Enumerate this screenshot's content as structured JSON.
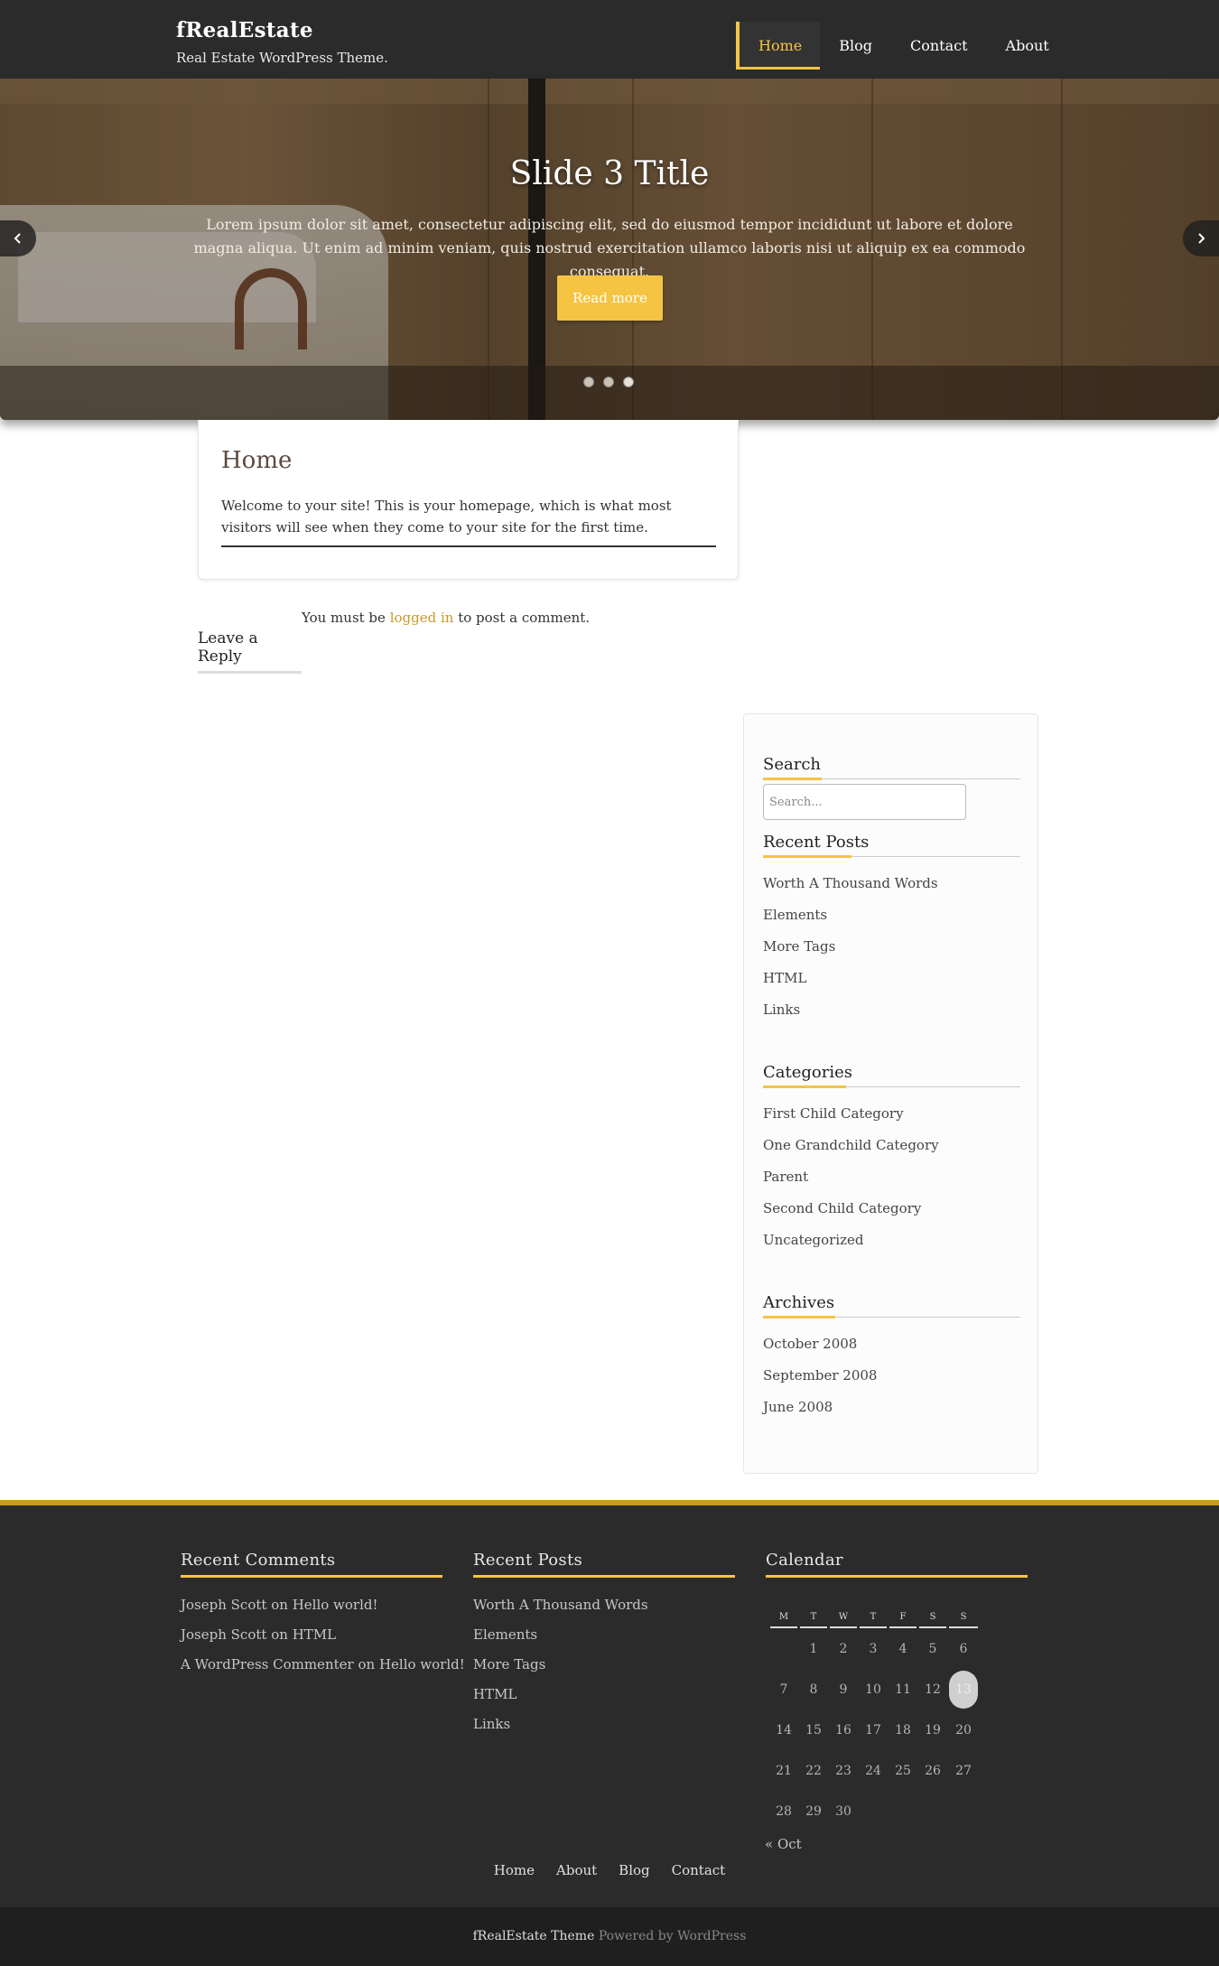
{
  "site": {
    "title": "fRealEstate",
    "tagline": "Real Estate WordPress Theme."
  },
  "nav": {
    "items": [
      {
        "label": "Home",
        "active": true
      },
      {
        "label": "Blog",
        "active": false
      },
      {
        "label": "Contact",
        "active": false
      },
      {
        "label": "About",
        "active": false
      }
    ]
  },
  "slider": {
    "title": "Slide 3 Title",
    "text": "Lorem ipsum dolor sit amet, consectetur adipiscing elit, sed do eiusmod tempor incididunt ut labore et dolore magna aliqua. Ut enim ad minim veniam, quis nostrud exercitation ullamco laboris nisi ut aliquip ex ea commodo consequat.",
    "button_label": "Read more",
    "slide_count": 3,
    "active_slide": 3,
    "prev_icon": "chevron-left-icon",
    "next_icon": "chevron-right-icon"
  },
  "page": {
    "title": "Home",
    "body": "Welcome to your site! This is your homepage, which is what most visitors will see when they come to your site for the first time."
  },
  "comments": {
    "note_prefix": "You must be ",
    "note_link": "logged in",
    "note_suffix": " to post a comment.",
    "reply_title": "Leave a Reply"
  },
  "sidebar": {
    "search": {
      "title": "Search",
      "placeholder": "Search..."
    },
    "recent_posts": {
      "title": "Recent Posts",
      "items": [
        "Worth A Thousand Words",
        "Elements",
        "More Tags",
        "HTML",
        "Links"
      ]
    },
    "categories": {
      "title": "Categories",
      "items": [
        "First Child Category",
        "One Grandchild Category",
        "Parent",
        "Second Child Category",
        "Uncategorized"
      ]
    },
    "archives": {
      "title": "Archives",
      "items": [
        "October 2008",
        "September 2008",
        "June 2008"
      ]
    }
  },
  "footer": {
    "recent_comments": {
      "title": "Recent Comments",
      "items": [
        {
          "author": "Joseph Scott",
          "on": "on",
          "post": "Hello world!"
        },
        {
          "author": "Joseph Scott",
          "on": "on",
          "post": "HTML"
        },
        {
          "author": "A WordPress Commenter",
          "on": "on",
          "post": "Hello world!"
        }
      ]
    },
    "recent_posts": {
      "title": "Recent Posts",
      "items": [
        "Worth A Thousand Words",
        "Elements",
        "More Tags",
        "HTML",
        "Links"
      ]
    },
    "calendar": {
      "title": "Calendar",
      "weekdays": [
        "M",
        "T",
        "W",
        "T",
        "F",
        "S",
        "S"
      ],
      "weeks": [
        [
          "",
          "1",
          "2",
          "3",
          "4",
          "5",
          "6"
        ],
        [
          "7",
          "8",
          "9",
          "10",
          "11",
          "12",
          "13"
        ],
        [
          "14",
          "15",
          "16",
          "17",
          "18",
          "19",
          "20"
        ],
        [
          "21",
          "22",
          "23",
          "24",
          "25",
          "26",
          "27"
        ],
        [
          "28",
          "29",
          "30",
          "",
          "",
          "",
          ""
        ]
      ],
      "today": "13",
      "prev_label": "« Oct"
    },
    "nav": [
      "Home",
      "About",
      "Blog",
      "Contact"
    ],
    "credits": {
      "theme": "fRealEstate Theme",
      "powered": "Powered by WordPress"
    }
  },
  "colors": {
    "accent": "#f6c443",
    "accent_dark": "#c89a28",
    "header_bg": "#2b2b2b",
    "footer_bg": "#2b2b2b",
    "bottom_bg": "#1f1f1f"
  }
}
